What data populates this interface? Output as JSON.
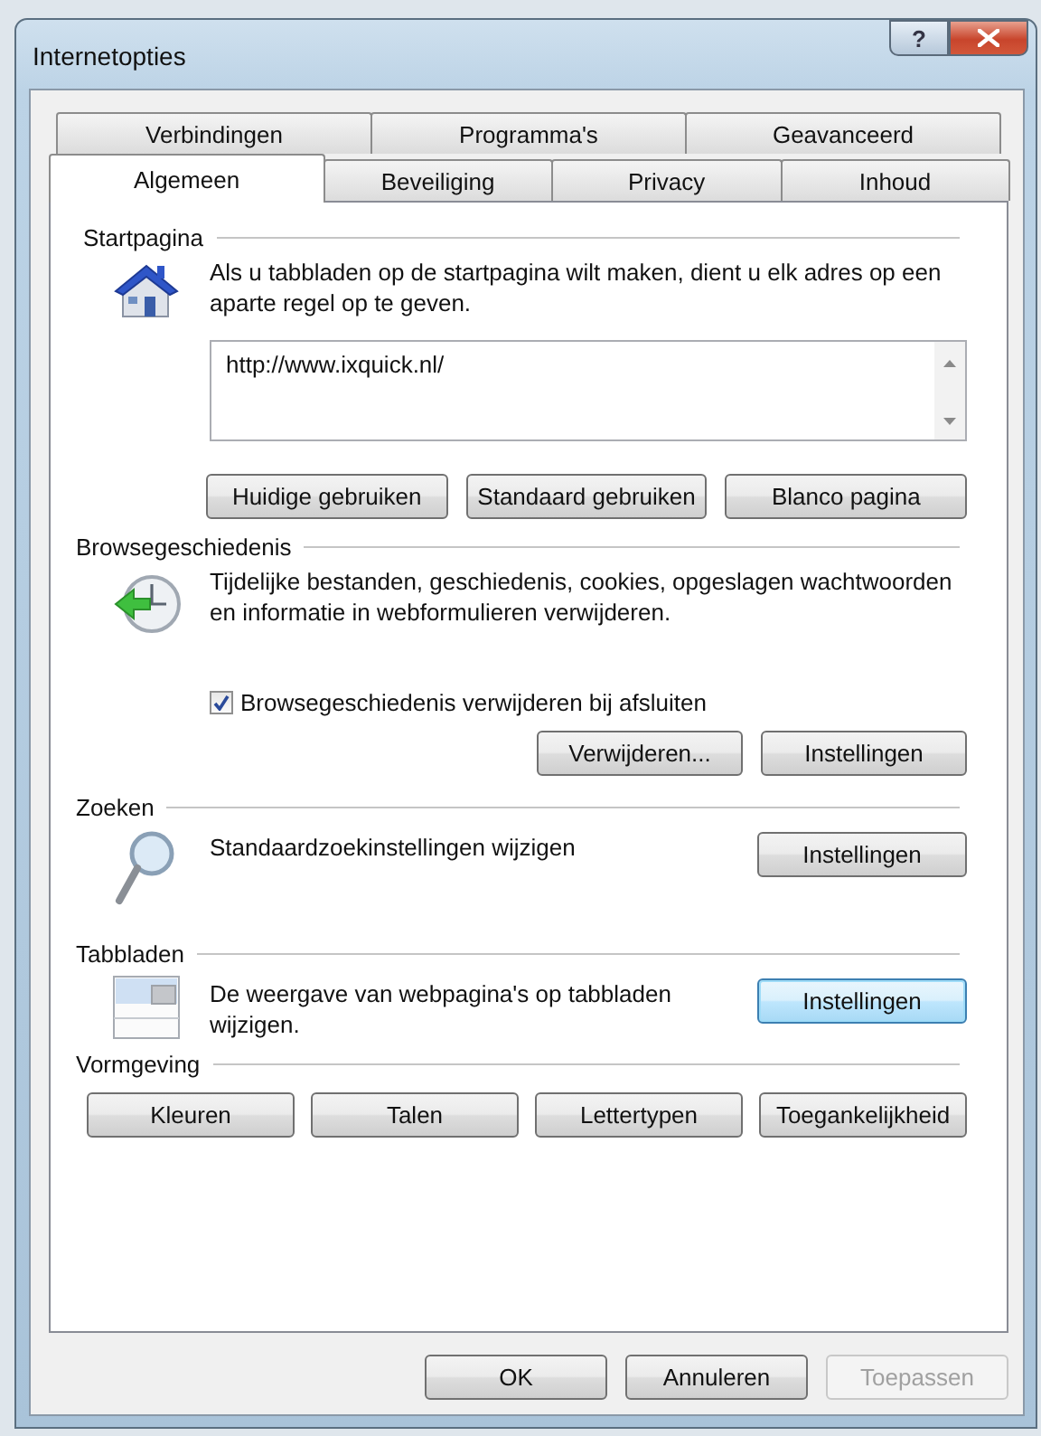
{
  "window": {
    "title": "Internetopties",
    "help_button": {
      "label": "?"
    }
  },
  "tab_rows": [
    [
      {
        "label": "Verbindingen",
        "selected": false
      },
      {
        "label": "Programma's",
        "selected": false
      },
      {
        "label": "Geavanceerd",
        "selected": false
      }
    ],
    [
      {
        "label": "Algemeen",
        "selected": true
      },
      {
        "label": "Beveiliging",
        "selected": false
      },
      {
        "label": "Privacy",
        "selected": false
      },
      {
        "label": "Inhoud",
        "selected": false
      }
    ]
  ],
  "sections": [
    {
      "kind": "home",
      "title": "Startpagina",
      "description": "Als u tabbladen op de startpagina wilt maken, dient u elk adres op een aparte regel op te geven.",
      "field": {
        "value": "http://www.ixquick.nl/"
      },
      "buttons": [
        {
          "label": "Huidige gebruiken",
          "default": false
        },
        {
          "label": "Standaard gebruiken",
          "default": false
        },
        {
          "label": "Blanco pagina",
          "default": false
        }
      ]
    },
    {
      "kind": "history",
      "title": "Browsegeschiedenis",
      "description": "Tijdelijke bestanden, geschiedenis, cookies, opgeslagen wachtwoorden en informatie in webformulieren verwijderen.",
      "checkbox": {
        "label": "Browsegeschiedenis verwijderen bij afsluiten",
        "checked": true
      },
      "buttons": [
        {
          "label": "Verwijderen...",
          "default": false
        },
        {
          "label": "Instellingen",
          "default": false
        }
      ]
    },
    {
      "kind": "search",
      "title": "Zoeken",
      "description": "Standaardzoekinstellingen wijzigen",
      "buttons": [
        {
          "label": "Instellingen",
          "default": false
        }
      ]
    },
    {
      "kind": "tabs",
      "title": "Tabbladen",
      "description": "De weergave van webpagina's op tabbladen wijzigen.",
      "buttons": [
        {
          "label": "Instellingen",
          "default": true
        }
      ]
    },
    {
      "kind": "appearance",
      "title": "Vormgeving",
      "buttons": [
        {
          "label": "Kleuren",
          "default": false
        },
        {
          "label": "Talen",
          "default": false
        },
        {
          "label": "Lettertypen",
          "default": false
        },
        {
          "label": "Toegankelijkheid",
          "default": false
        }
      ]
    }
  ],
  "footer_buttons": [
    {
      "label": "OK",
      "disabled": false
    },
    {
      "label": "Annuleren",
      "disabled": false
    },
    {
      "label": "Toepassen",
      "disabled": true
    }
  ]
}
